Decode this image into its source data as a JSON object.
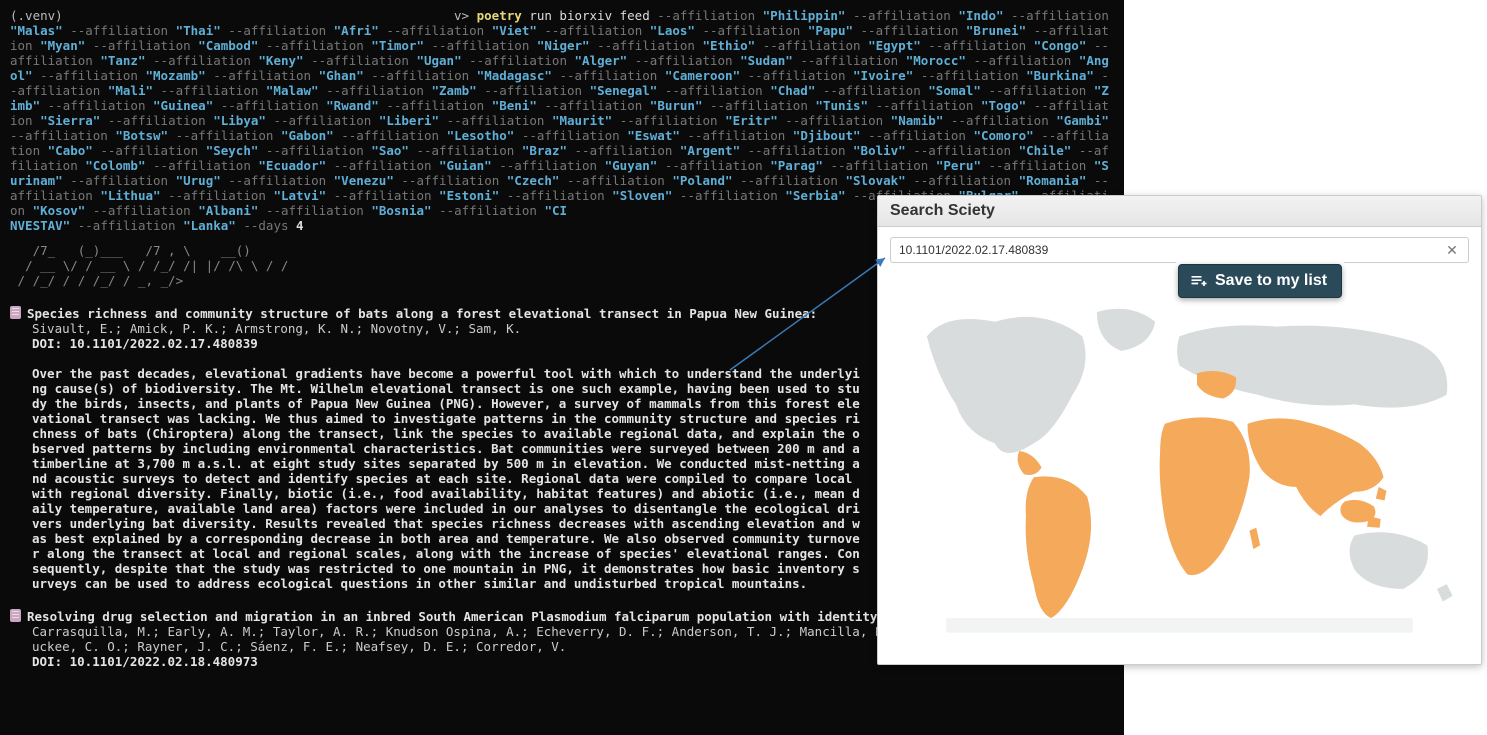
{
  "terminal": {
    "prompt_venv": "(.venv)",
    "prompt_suffix": "v>",
    "cmd_main": "poetry",
    "cmd_rest": "run biorxiv feed",
    "flag": "--affiliation",
    "days_flag": "--days",
    "days_value": "4",
    "last_tokens": [
      "NVESTAV",
      "Lanka"
    ],
    "affiliations": [
      "Philippin",
      "Indo",
      "Malas",
      "Thai",
      "Afri",
      "Viet",
      "Laos",
      "Papu",
      "Brunei",
      "Myan",
      "Cambod",
      "Timor",
      "Niger",
      "Ethio",
      "Egypt",
      "Congo",
      "Tanz",
      "Keny",
      "Ugan",
      "Alger",
      "Sudan",
      "Morocc",
      "Angol",
      "Mozamb",
      "Ghan",
      "Madagasc",
      "Cameroon",
      "Ivoire",
      "Burkina",
      "Mali",
      "Malaw",
      "Zamb",
      "Senegal",
      "Chad",
      "Somal",
      "Zimb",
      "Guinea",
      "Rwand",
      "Beni",
      "Burun",
      "Tunis",
      "Togo",
      "Sierra",
      "Libya",
      "Liberi",
      "Maurit",
      "Eritr",
      "Namib",
      "Gambi",
      "Botsw",
      "Gabon",
      "Lesotho",
      "Eswat",
      "Djibout",
      "Comoro",
      "Cabo",
      "Seych",
      "Sao",
      "Braz",
      "Argent",
      "Boliv",
      "Chile",
      "Colomb",
      "Ecuador",
      "Guian",
      "Guyan",
      "Parag",
      "Peru",
      "Surinam",
      "Urug",
      "Venezu",
      "Czech",
      "Poland",
      "Slovak",
      "Romania",
      "Lithua",
      "Latvi",
      "Estoni",
      "Sloven",
      "Serbia",
      "Bulgar",
      "Kosov",
      "Albani",
      "Bosnia"
    ],
    "ascii": "   /7_   (_)___   /7 , \\    __()\n  / __ \\/ / __ \\ / /_/ /| |/ /\\ \\ / /\n / /_/ / / /_/ / _, _/>  </ /| |/ /\n/_.___/_/\\____/_/ |_|/_/|_/_/ |___/",
    "articles": [
      {
        "title": "Species richness and community structure of bats along a forest elevational transect in Papua New Guinea:",
        "authors": "Sivault, E.; Amick, P. K.; Armstrong, K. N.; Novotny, V.; Sam, K.",
        "doi": "DOI: 10.1101/2022.02.17.480839",
        "abstract": "Over the past decades, elevational gradients have become a powerful tool with which to understand the underlying cause(s) of biodiversity. The Mt. Wilhelm elevational transect is one such example, having been used to study the birds, insects, and plants of Papua New Guinea (PNG). However, a survey of mammals from this forest elevational transect was lacking. We thus aimed to investigate patterns in the community structure and species richness of bats (Chiroptera) along the transect, link the species to available regional data, and explain the observed patterns by including environmental characteristics. Bat communities were surveyed between 200 m and a timberline at 3,700 m a.s.l. at eight study sites separated by 500 m in elevation. We conducted mist-netting and acoustic surveys to detect and identify species at each site. Regional data were compiled to compare local with regional diversity. Finally, biotic (i.e., food availability, habitat features) and abiotic (i.e., mean daily temperature, available land area) factors were included in our analyses to disentangle the ecological drivers underlying bat diversity. Results revealed that species richness decreases with ascending elevation and was best explained by a corresponding decrease in both area and temperature. We also observed community turnover along the transect at local and regional scales, along with the increase of species' elevational ranges. Consequently, despite that the study was restricted to one mountain in PNG, it demonstrates how basic inventory surveys can be used to address ecological questions in other similar and undisturbed tropical mountains."
      },
      {
        "title": "Resolving drug selection and migration in an inbred South American Plasmodium falciparum population with identity-by-descent analysis:",
        "authors": "Carrasquilla, M.; Early, A. M.; Taylor, A. R.; Knudson Ospina, A.; Echeverry, D. F.; Anderson, T. J.; Mancilla, E.; Aponte, S.; C&aacuterdenas, P.; Buckee, C. O.; Rayner, J. C.; S&aacuteenz, F. E.; Neafsey, D. E.; Corredor, V.",
        "doi": "DOI: 10.1101/2022.02.18.480973",
        "abstract": ""
      }
    ]
  },
  "panel": {
    "title": "Search Sciety",
    "search_value": "10.1101/2022.02.17.480839",
    "save_label": "Save to my list"
  }
}
